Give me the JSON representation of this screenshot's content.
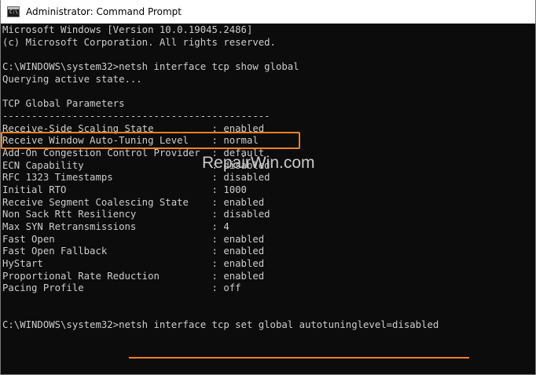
{
  "window": {
    "title": "Administrator: Command Prompt",
    "icon_text": "C:\\"
  },
  "console": {
    "lines": [
      "Microsoft Windows [Version 10.0.19045.2486]",
      "(c) Microsoft Corporation. All rights reserved.",
      "",
      "C:\\WINDOWS\\system32>netsh interface tcp show global",
      "Querying active state...",
      "",
      "TCP Global Parameters",
      "----------------------------------------------",
      "Receive-Side Scaling State          : enabled",
      "Receive Window Auto-Tuning Level    : normal",
      "Add-On Congestion Control Provider  : default",
      "ECN Capability                      : disabled",
      "RFC 1323 Timestamps                 : disabled",
      "Initial RTO                         : 1000",
      "Receive Segment Coalescing State    : enabled",
      "Non Sack Rtt Resiliency             : disabled",
      "Max SYN Retransmissions             : 4",
      "Fast Open                           : enabled",
      "Fast Open Fallback                  : enabled",
      "HyStart                             : enabled",
      "Proportional Rate Reduction         : enabled",
      "Pacing Profile                      : off",
      "",
      "",
      "C:\\WINDOWS\\system32>netsh interface tcp set global autotuninglevel=disabled"
    ]
  },
  "watermark": "RepairWin.com",
  "colors": {
    "console_bg": "#0c0c0c",
    "console_text": "#cccccc",
    "highlight": "#f08020"
  }
}
